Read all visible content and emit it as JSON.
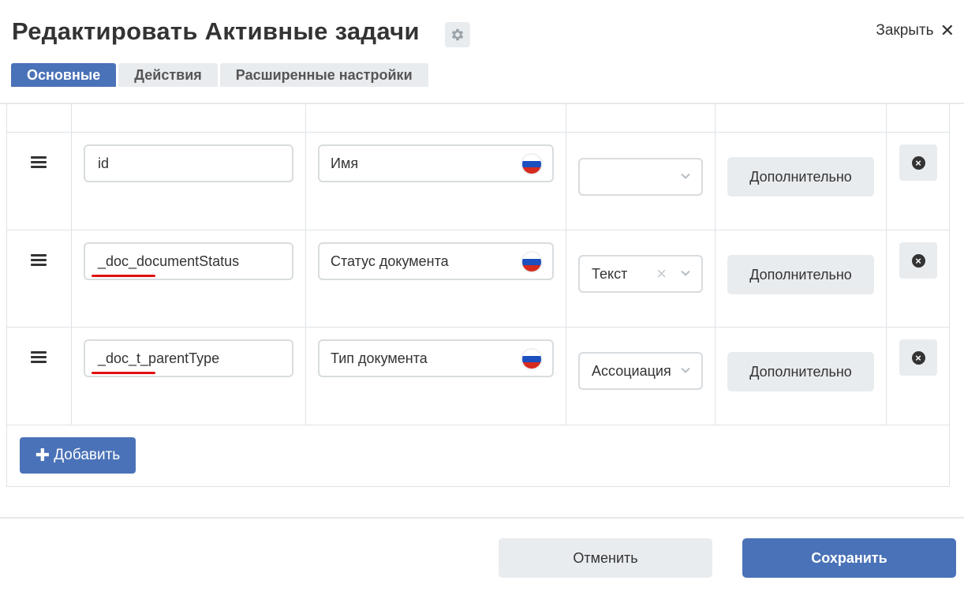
{
  "header": {
    "title": "Редактировать Активные задачи",
    "close_label": "Закрыть",
    "settings_icon": "gear-icon",
    "close_icon": "close-icon"
  },
  "tabs": [
    {
      "label": "Основные",
      "active": true
    },
    {
      "label": "Действия",
      "active": false
    },
    {
      "label": "Расширенные настройки",
      "active": false
    }
  ],
  "rows": [
    {
      "field": "id",
      "name": "Имя",
      "type": "",
      "more_label": "Дополнительно"
    },
    {
      "field": "_doc_documentStatus",
      "name": "Статус документа",
      "type": "Текст",
      "more_label": "Дополнительно"
    },
    {
      "field": "_doc_t_parentType",
      "name": "Тип документа",
      "type": "Ассоциация",
      "more_label": "Дополнительно"
    }
  ],
  "add_button": {
    "label": "Добавить"
  },
  "footer": {
    "cancel_label": "Отменить",
    "save_label": "Сохранить"
  },
  "colors": {
    "accent": "#4a72b8",
    "button_gray": "#e9ecef",
    "border": "#dfe3e7",
    "spell_underline": "#e01010",
    "flag_white": "#ffffff",
    "flag_blue": "#1c4fbf",
    "flag_red": "#d52b1e"
  }
}
